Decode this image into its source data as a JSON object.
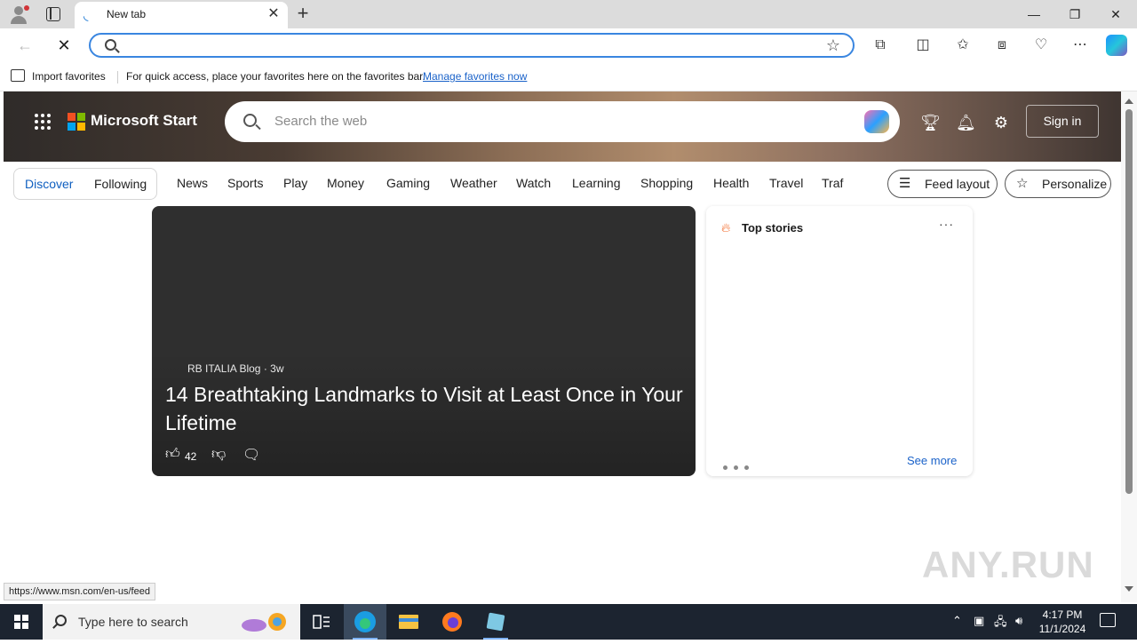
{
  "browser": {
    "tab_title": "New tab",
    "tab_close": "✕",
    "new_tab": "+",
    "window_controls": {
      "minimize": "—",
      "restore": "❐",
      "close": "✕"
    }
  },
  "favorites_bar": {
    "import_label": "Import favorites",
    "hint": "For quick access, place your favorites here on the favorites bar.",
    "manage_link": "Manage favorites now"
  },
  "header": {
    "brand": "Microsoft Start",
    "search_placeholder": "Search the web",
    "signin_label": "Sign in"
  },
  "tabs": {
    "discover": "Discover",
    "following": "Following"
  },
  "categories": [
    "News",
    "Sports",
    "Play",
    "Money",
    "Gaming",
    "Weather",
    "Watch",
    "Learning",
    "Shopping",
    "Health",
    "Travel",
    "Traf"
  ],
  "buttons": {
    "feed_layout": "Feed layout",
    "personalize": "Personalize"
  },
  "feature_card": {
    "source": "RB ITALIA Blog",
    "age": "3w",
    "headline": "14 Breathtaking Landmarks to Visit at Least Once in Your Lifetime",
    "likes": "42"
  },
  "top_stories": {
    "title": "Top stories",
    "more": "···",
    "see_more": "See more"
  },
  "status_url": "https://www.msn.com/en-us/feed",
  "watermark": "ANY.RUN",
  "taskbar": {
    "search_placeholder": "Type here to search",
    "time": "4:17 PM",
    "date": "11/1/2024"
  },
  "colors": {
    "accent": "#0f5fc0",
    "link": "#1a62c9",
    "omnibox_border": "#3a86e0",
    "taskbar": "#1c2430"
  }
}
